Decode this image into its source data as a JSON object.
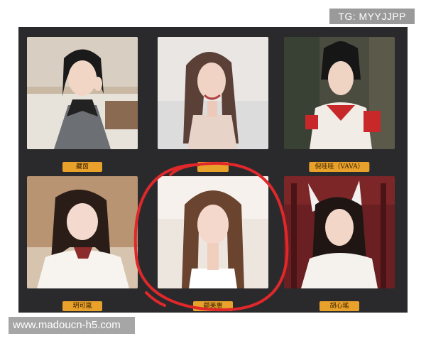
{
  "watermark": {
    "tg": "TG: MYYJJPP",
    "url": "www.madoucn-h5.com"
  },
  "cards": [
    {
      "name": "藏茵"
    },
    {
      "name": ""
    },
    {
      "name": "倪哇哇（VAVA）"
    },
    {
      "name": "玥可嵐"
    },
    {
      "name": "顧美惠"
    },
    {
      "name": "胡心瑤"
    }
  ],
  "colors": {
    "board": "#2a2a2d",
    "label": "#e8a12a",
    "highlight_circle": "#e0282a"
  },
  "highlight": {
    "card_index": 4
  }
}
